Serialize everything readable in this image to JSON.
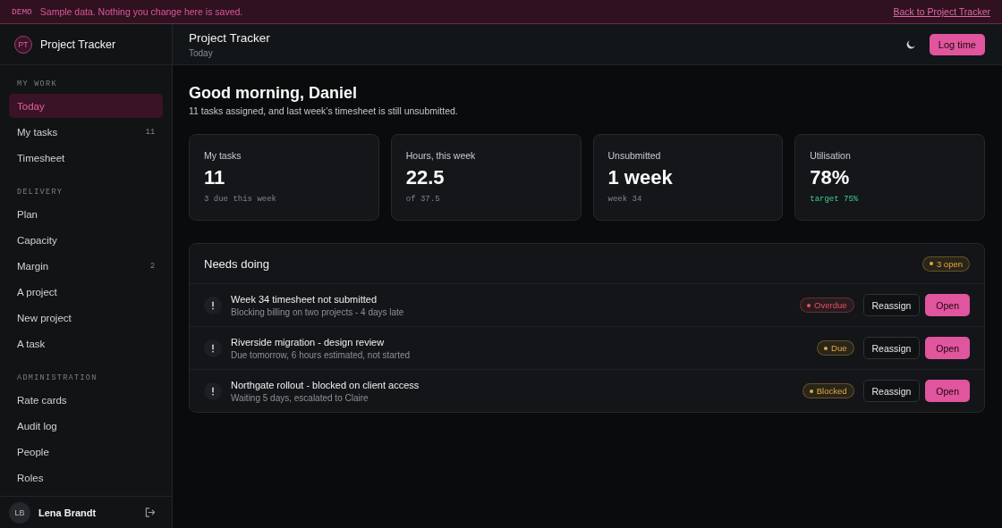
{
  "banner": {
    "tag": "DEMO",
    "message": "Sample data. Nothing you change here is saved.",
    "link": "Back to Project Tracker"
  },
  "sidebar": {
    "brand": {
      "initials": "PT",
      "name": "Project Tracker"
    },
    "sections": [
      {
        "heading": "MY WORK",
        "items": [
          {
            "label": "Today",
            "selected": true
          },
          {
            "label": "My tasks",
            "count": "11",
            "selected": false
          },
          {
            "label": "Timesheet",
            "selected": false
          }
        ]
      },
      {
        "heading": "DELIVERY",
        "items": [
          {
            "label": "Plan",
            "selected": false
          },
          {
            "label": "Capacity",
            "selected": false
          },
          {
            "label": "Margin",
            "count": "2",
            "selected": false
          },
          {
            "label": "A project",
            "selected": false
          },
          {
            "label": "New project",
            "selected": false
          },
          {
            "label": "A task",
            "selected": false
          }
        ]
      },
      {
        "heading": "ADMINISTRATION",
        "items": [
          {
            "label": "Rate cards",
            "selected": false
          },
          {
            "label": "Audit log",
            "selected": false
          },
          {
            "label": "People",
            "selected": false
          },
          {
            "label": "Roles",
            "selected": false
          }
        ]
      }
    ],
    "user": {
      "initials": "LB",
      "name": "Lena Brandt"
    }
  },
  "header": {
    "title": "Project Tracker",
    "subtitle": "Today",
    "action": "Log time"
  },
  "greeting": {
    "title": "Good morning, Daniel",
    "text": "11 tasks assigned, and last week’s timesheet is still unsubmitted."
  },
  "stats": [
    {
      "label": "My tasks",
      "value": "11",
      "note": "3 due this week",
      "positive": false
    },
    {
      "label": "Hours, this week",
      "value": "22.5",
      "note": "of 37.5",
      "positive": false
    },
    {
      "label": "Unsubmitted",
      "value": "1 week",
      "note": "week 34",
      "positive": false
    },
    {
      "label": "Utilisation",
      "value": "78%",
      "note": "target 75%",
      "positive": true
    }
  ],
  "needs": {
    "title": "Needs doing",
    "badge": {
      "label": "3 open",
      "color": "#e3a93b"
    },
    "items": [
      {
        "title": "Week 34 timesheet not submitted",
        "detail": "Blocking billing on two projects - 4 days late",
        "status": {
          "label": "Overdue",
          "color": "#e5545b"
        },
        "actions": [
          {
            "label": "Reassign",
            "kind": "secondary"
          },
          {
            "label": "Open",
            "kind": "primary"
          }
        ]
      },
      {
        "title": "Riverside migration - design review",
        "detail": "Due tomorrow, 6 hours estimated, not started",
        "status": {
          "label": "Due",
          "color": "#e3a93b"
        },
        "actions": [
          {
            "label": "Reassign",
            "kind": "secondary"
          },
          {
            "label": "Open",
            "kind": "primary"
          }
        ]
      },
      {
        "title": "Northgate rollout - blocked on client access",
        "detail": "Waiting 5 days, escalated to Claire",
        "status": {
          "label": "Blocked",
          "color": "#e3a93b"
        },
        "actions": [
          {
            "label": "Reassign",
            "kind": "secondary"
          },
          {
            "label": "Open",
            "kind": "primary"
          }
        ]
      }
    ]
  }
}
